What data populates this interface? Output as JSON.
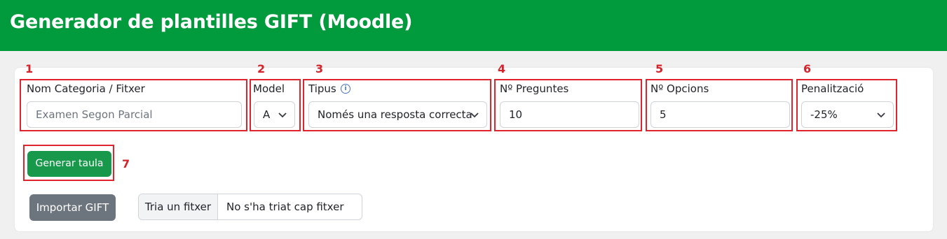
{
  "header": {
    "title": "Generador de plantilles GIFT (Moodle)",
    "background_color": "#019a3d"
  },
  "form": {
    "category": {
      "label": "Nom Categoria / Fitxer",
      "placeholder": "Examen Segon Parcial"
    },
    "model": {
      "label": "Model",
      "selected": "A"
    },
    "tipus": {
      "label": "Tipus",
      "info_icon": "info-circle-icon",
      "selected": "Només una resposta correcta"
    },
    "num_preguntes": {
      "label": "Nº Preguntes",
      "value": "10"
    },
    "num_opcions": {
      "label": "Nº Opcions",
      "value": "5"
    },
    "penalitzacio": {
      "label": "Penalització",
      "selected": "-25%"
    }
  },
  "actions": {
    "generate_label": "Generar taula",
    "import_label": "Importar GIFT",
    "file_button_label": "Tria un fitxer",
    "file_status": "No s'ha triat cap fitxer"
  },
  "annotations": {
    "color": "#e0242d",
    "numbers": [
      "1",
      "2",
      "3",
      "4",
      "5",
      "6",
      "7"
    ]
  }
}
